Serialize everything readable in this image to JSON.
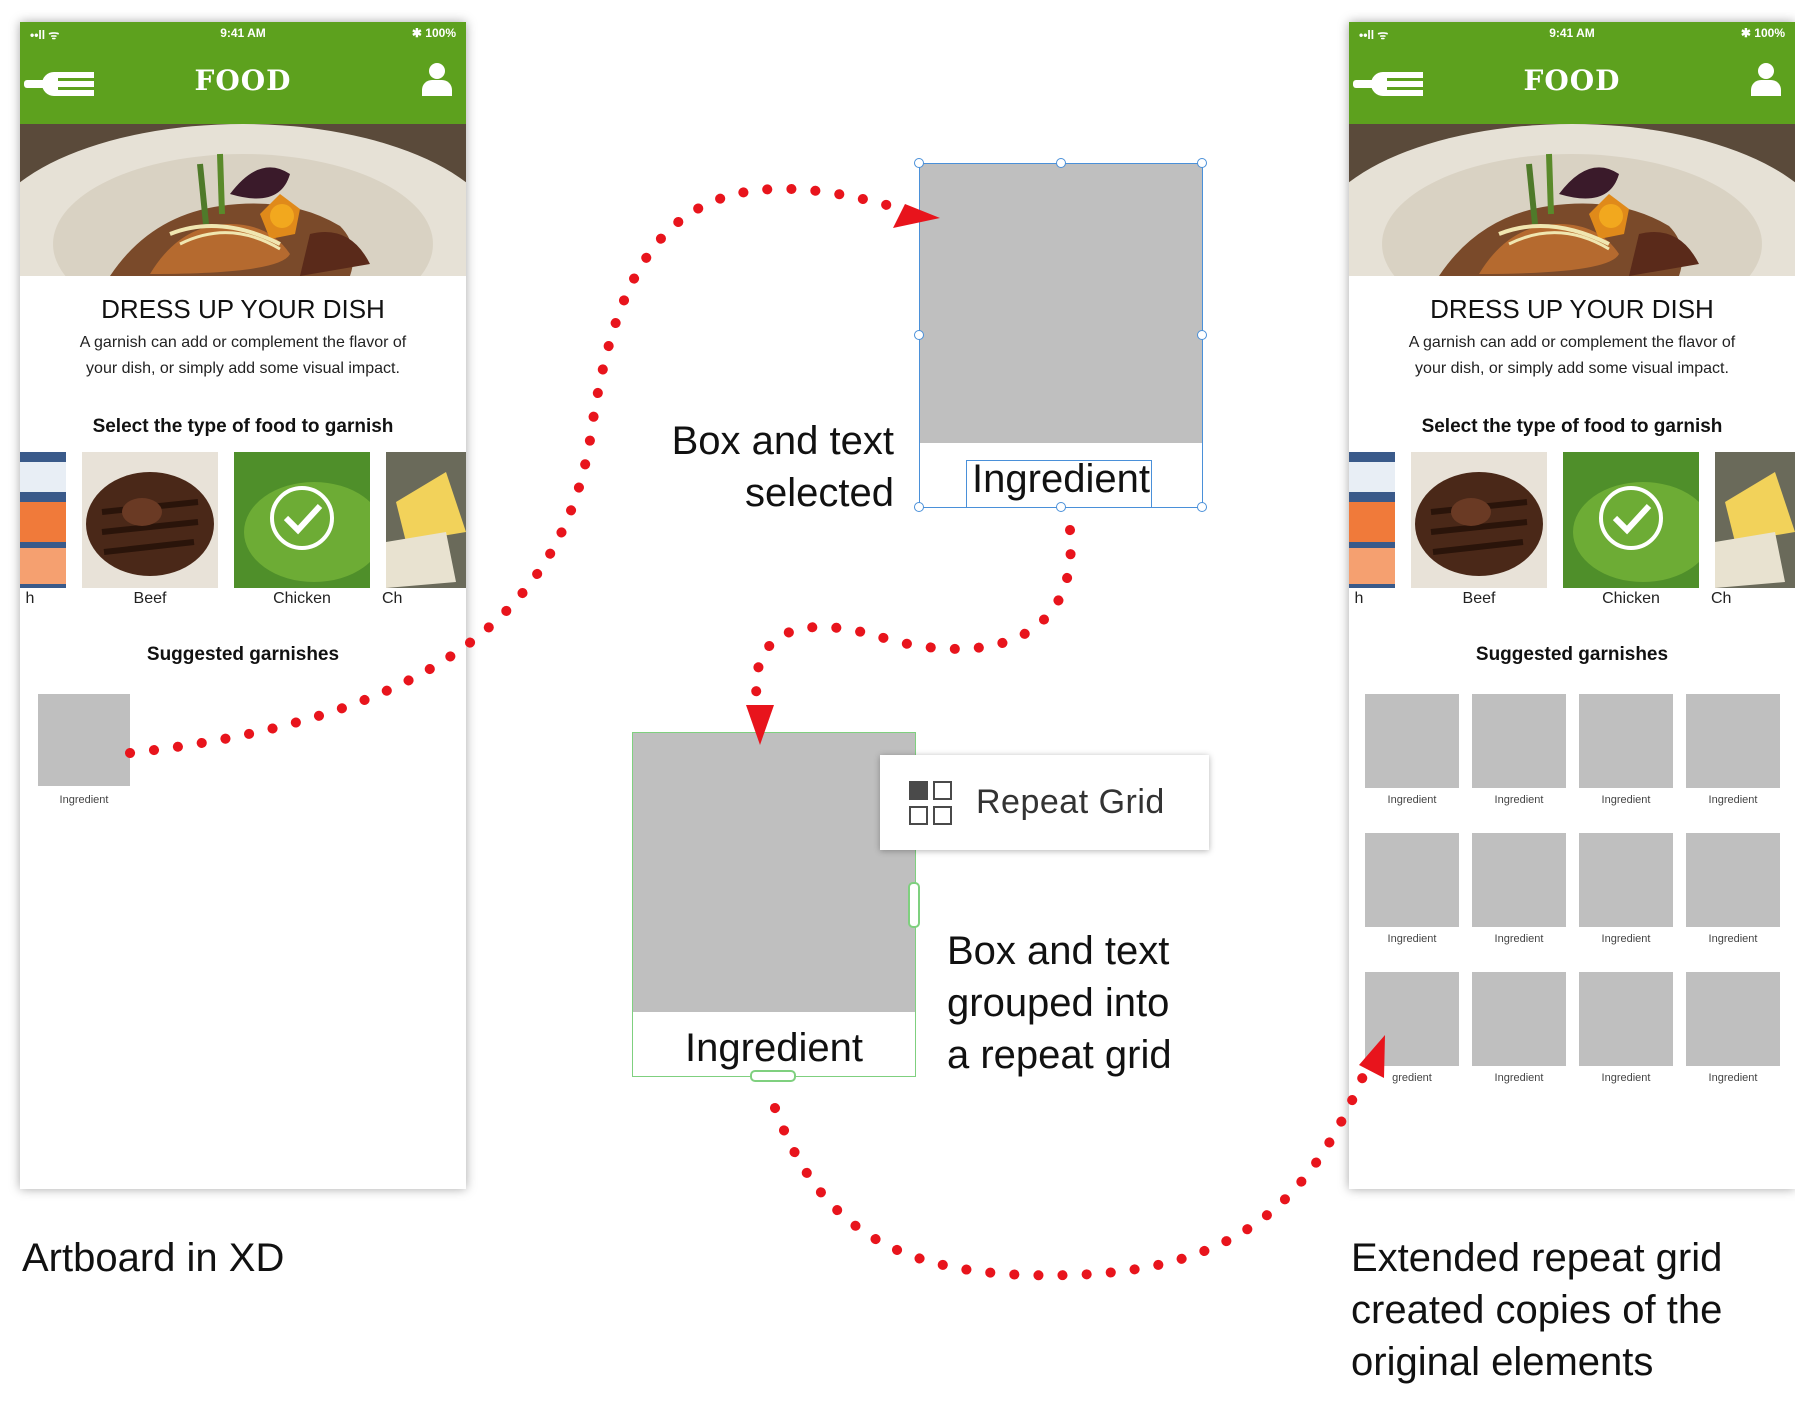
{
  "left_phone": {
    "status": {
      "signal": "••ll ᯤ",
      "time": "9:41 AM",
      "battery": "✱ 100%"
    },
    "app_title": "FOOD",
    "heading": "DRESS UP YOUR DISH",
    "subtext_line1": "A garnish can add or complement the flavor of",
    "subtext_line2": "your dish, or simply add some visual impact.",
    "select_label": "Select the type of food to garnish",
    "foods": [
      {
        "label": "h"
      },
      {
        "label": "Beef"
      },
      {
        "label": "Chicken"
      },
      {
        "label": "Ch"
      }
    ],
    "suggested_label": "Suggested garnishes",
    "ingredient_label": "Ingredient"
  },
  "right_phone": {
    "status": {
      "signal": "••ll ᯤ",
      "time": "9:41 AM",
      "battery": "✱ 100%"
    },
    "app_title": "FOOD",
    "heading": "DRESS UP YOUR DISH",
    "subtext_line1": "A garnish can add or complement the flavor of",
    "subtext_line2": "your dish, or simply add some visual impact.",
    "select_label": "Select the type of food to garnish",
    "foods": [
      {
        "label": "h"
      },
      {
        "label": "Beef"
      },
      {
        "label": "Chicken"
      },
      {
        "label": "Ch"
      }
    ],
    "suggested_label": "Suggested garnishes",
    "grid_labels": [
      "Ingredient",
      "Ingredient",
      "Ingredient",
      "Ingredient",
      "Ingredient",
      "Ingredient",
      "Ingredient",
      "Ingredient",
      "gredient",
      "Ingredient",
      "Ingredient",
      "Ingredient"
    ]
  },
  "selected_component": {
    "label": "Ingredient"
  },
  "repeat_component": {
    "label": "Ingredient"
  },
  "repeat_grid_button": {
    "label": "Repeat Grid",
    "icon": "repeat-grid-icon"
  },
  "callouts": {
    "selected_line1": "Box and text",
    "selected_line2": "selected",
    "grouped_line1": "Box and text",
    "grouped_line2": "grouped into",
    "grouped_line3": "a repeat grid"
  },
  "captions": {
    "left": "Artboard in XD",
    "right_line1": "Extended repeat grid",
    "right_line2": "created copies of the",
    "right_line3": "original elements"
  },
  "colors": {
    "app_green": "#5da11e",
    "placeholder_gray": "#bfbfbf",
    "selection_blue": "#4a90d9",
    "grid_green": "#7fd07f",
    "arrow_red": "#e8141c"
  }
}
